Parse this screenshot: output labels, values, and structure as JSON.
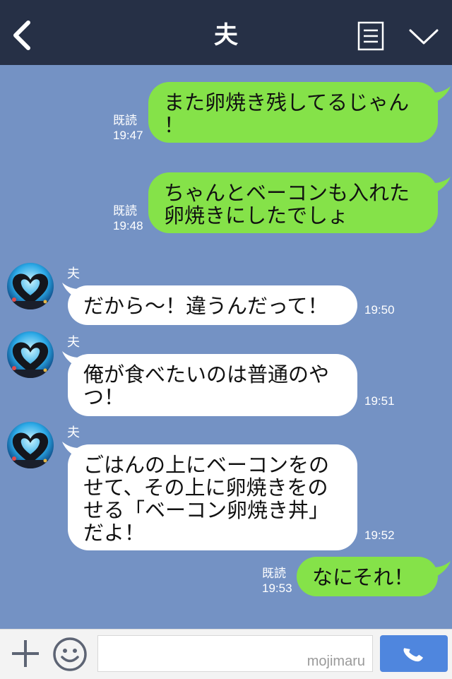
{
  "header": {
    "title": "夫"
  },
  "messages": [
    {
      "direction": "out",
      "text_lines": [
        "また卵焼き残してるじゃん",
        "！"
      ],
      "read_label": "既読",
      "time": "19:47"
    },
    {
      "direction": "out",
      "text_lines": [
        "ちゃんとベーコンも入れた",
        "卵焼きにしたでしょ"
      ],
      "read_label": "既読",
      "time": "19:48"
    },
    {
      "direction": "in",
      "sender": "夫",
      "text_lines": [
        "だから〜！違うんだって！"
      ],
      "time": "19:50"
    },
    {
      "direction": "in",
      "sender": "夫",
      "text_lines": [
        "俺が食べたいのは普通のや",
        "つ！"
      ],
      "time": "19:51"
    },
    {
      "direction": "in",
      "sender": "夫",
      "text_lines": [
        "ごはんの上にベーコンをの",
        "せて、その上に卵焼きをの",
        "せる「ベーコン卵焼き丼」",
        "だよ！"
      ],
      "time": "19:52"
    },
    {
      "direction": "out",
      "text_lines": [
        "なにそれ！"
      ],
      "read_label": "既読",
      "time": "19:53"
    }
  ],
  "input": {
    "watermark": "mojimaru"
  },
  "colors": {
    "chat_background": "#7492c4",
    "header_background": "#263046",
    "outgoing_bubble": "#85e249",
    "incoming_bubble": "#ffffff",
    "call_button": "#4f86de"
  },
  "icons": [
    "back-arrow-icon",
    "menu-list-icon",
    "chevron-down-icon",
    "plus-icon",
    "emoji-icon",
    "phone-icon"
  ]
}
